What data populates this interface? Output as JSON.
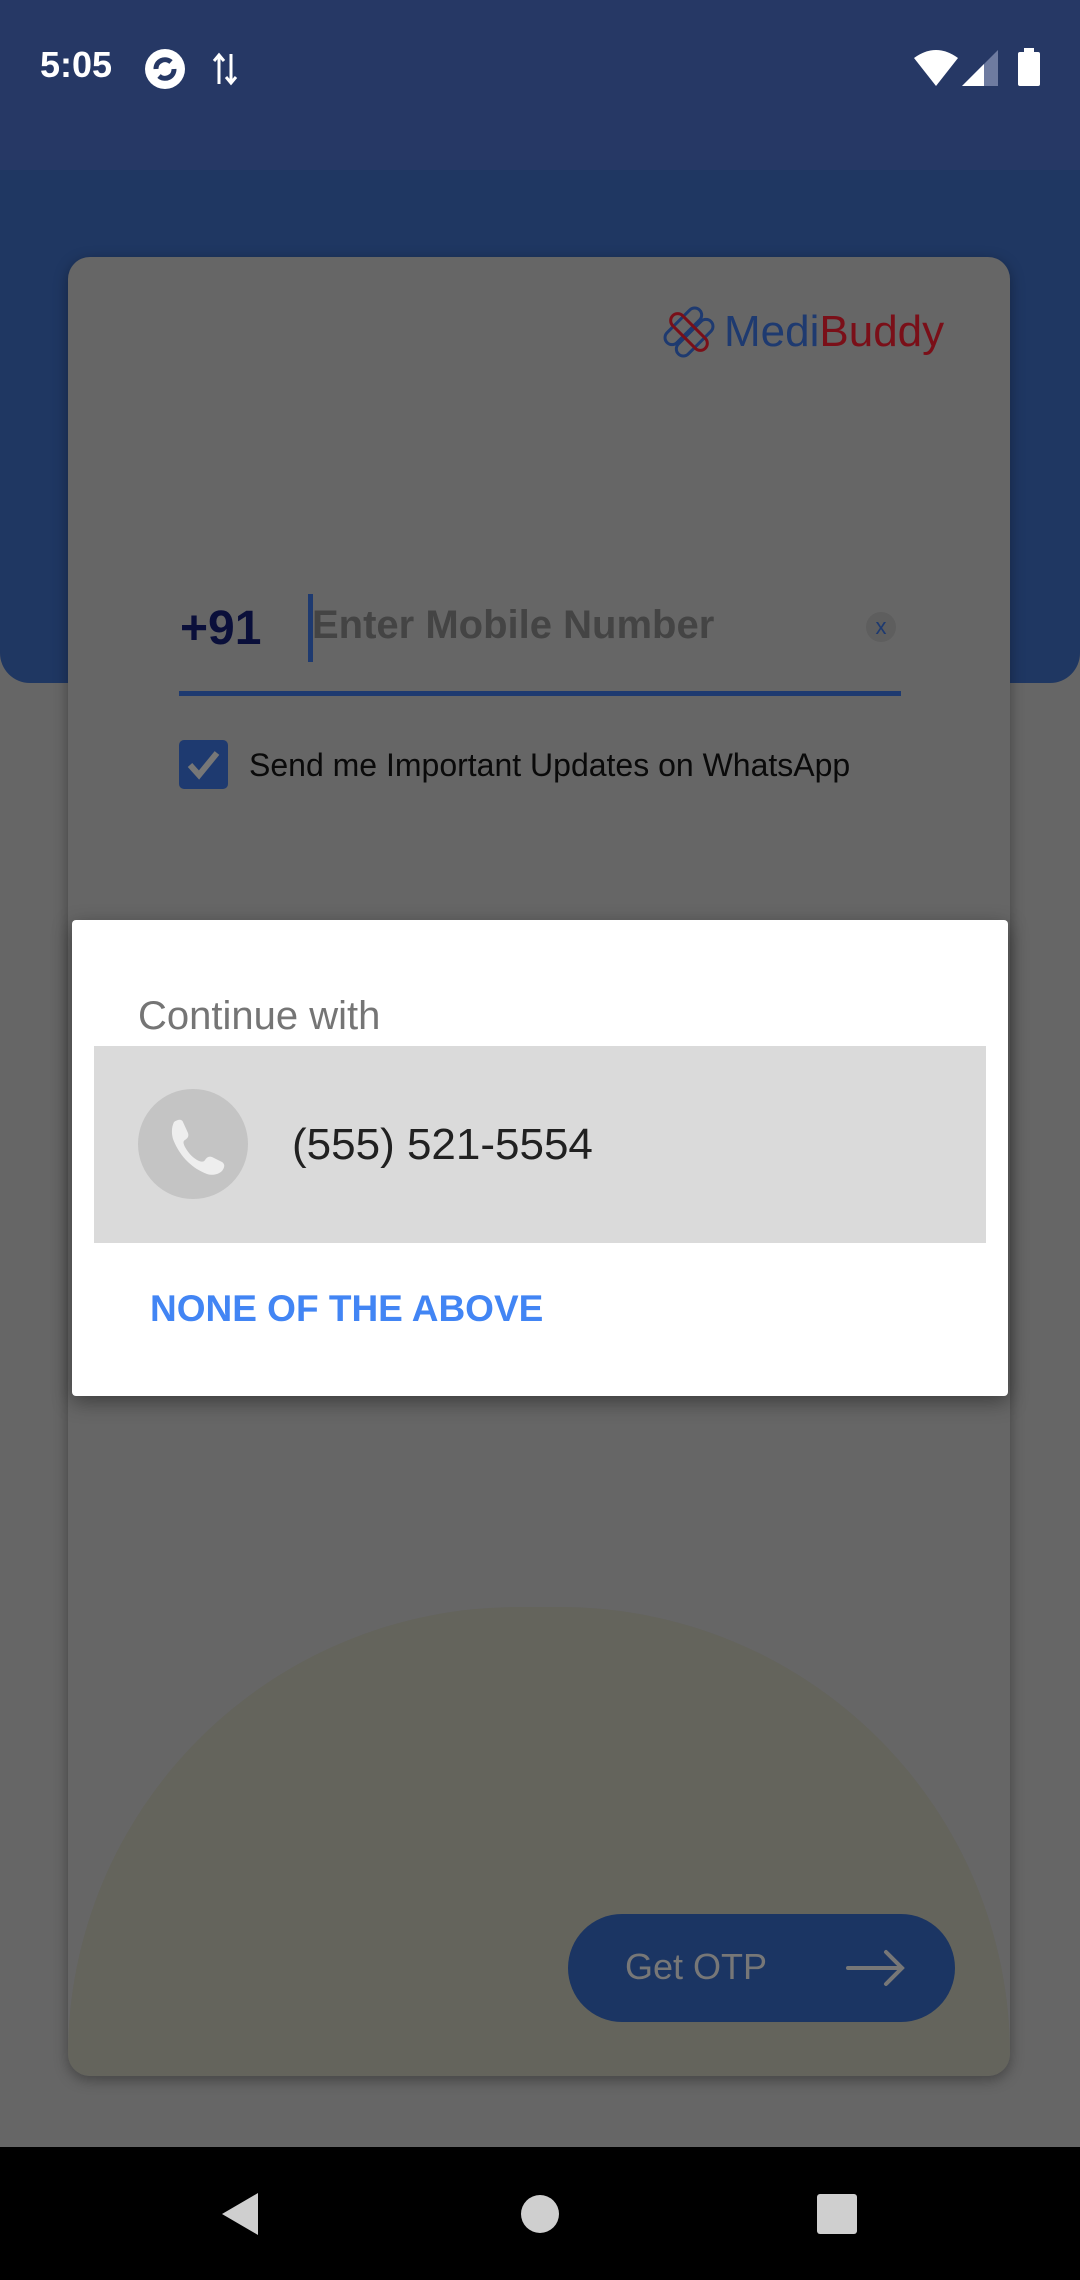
{
  "status_bar": {
    "time": "5:05",
    "icons": [
      "sync-icon",
      "data-transfer-icon",
      "wifi-icon",
      "signal-icon",
      "battery-icon"
    ]
  },
  "app": {
    "logo": {
      "part1": "Medi",
      "part2": "Buddy"
    },
    "country_code": "+91",
    "mobile_input": {
      "value": "",
      "placeholder": "Enter Mobile Number"
    },
    "clear_label": "x",
    "whatsapp_checkbox": {
      "checked": true,
      "label": "Send me Important Updates on WhatsApp"
    },
    "get_otp_label": "Get OTP"
  },
  "dialog": {
    "title": "Continue with",
    "accounts": [
      {
        "phone": "(555) 521-5554"
      }
    ],
    "none_label": "NONE OF THE ABOVE"
  },
  "colors": {
    "primary": "#3b63c6",
    "link": "#4285f4",
    "logo_blue": "#1e3a70",
    "logo_red": "#7a0f18"
  }
}
